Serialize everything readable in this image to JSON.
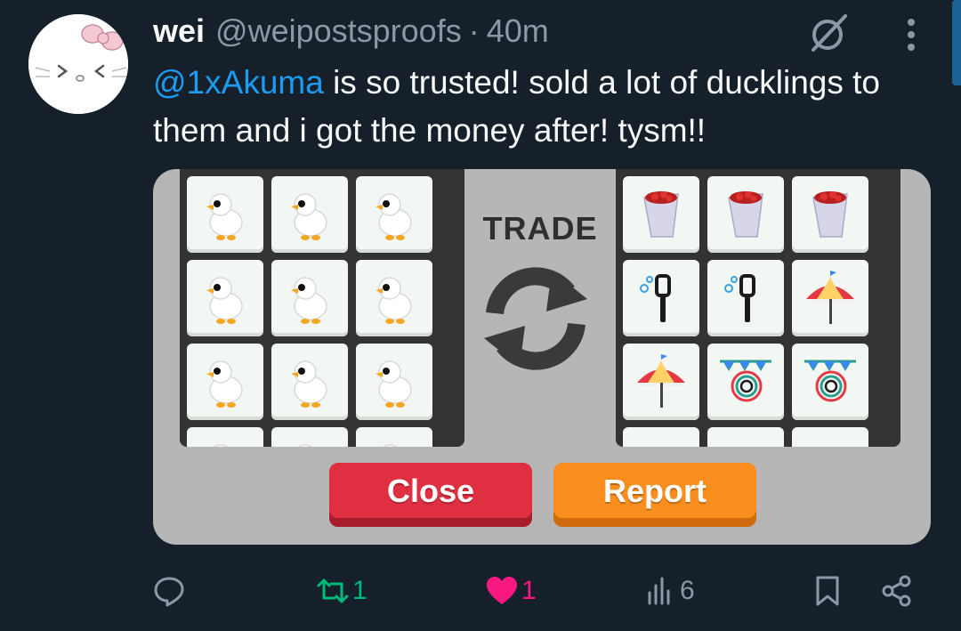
{
  "author": {
    "name": "wei",
    "handle": "@weipostsproofs",
    "separator": "·",
    "time": "40m",
    "avatar_icon": "hello-kitty-avatar"
  },
  "post": {
    "mention": "@1xAkuma",
    "text": " is so trusted! sold a lot of ducklings to them and i got the money after! tysm!!"
  },
  "media": {
    "trade_label": "TRADE",
    "close_label": "Close",
    "report_label": "Report",
    "left_items": [
      "duckling",
      "duckling",
      "duckling",
      "duckling",
      "duckling",
      "duckling",
      "duckling",
      "duckling",
      "duckling",
      "duckling",
      "duckling",
      "duckling"
    ],
    "right_items": [
      "berry-bag",
      "berry-bag",
      "berry-bag",
      "bubble-wand",
      "bubble-wand",
      "carnival-umbrella",
      "carnival-umbrella",
      "party-ring",
      "party-ring",
      "item",
      "item",
      "item"
    ],
    "colors": {
      "close": "#e12f42",
      "report": "#f98d1e",
      "panel": "#333333",
      "frame": "#b6b6b6"
    }
  },
  "actions": {
    "reply": "",
    "retweet": "1",
    "like": "1",
    "views": "6"
  },
  "colors": {
    "background": "#15202b",
    "accent": "#1d9bf0",
    "retweet": "#00ba7c",
    "like": "#f91880",
    "muted": "#8b98a5"
  }
}
